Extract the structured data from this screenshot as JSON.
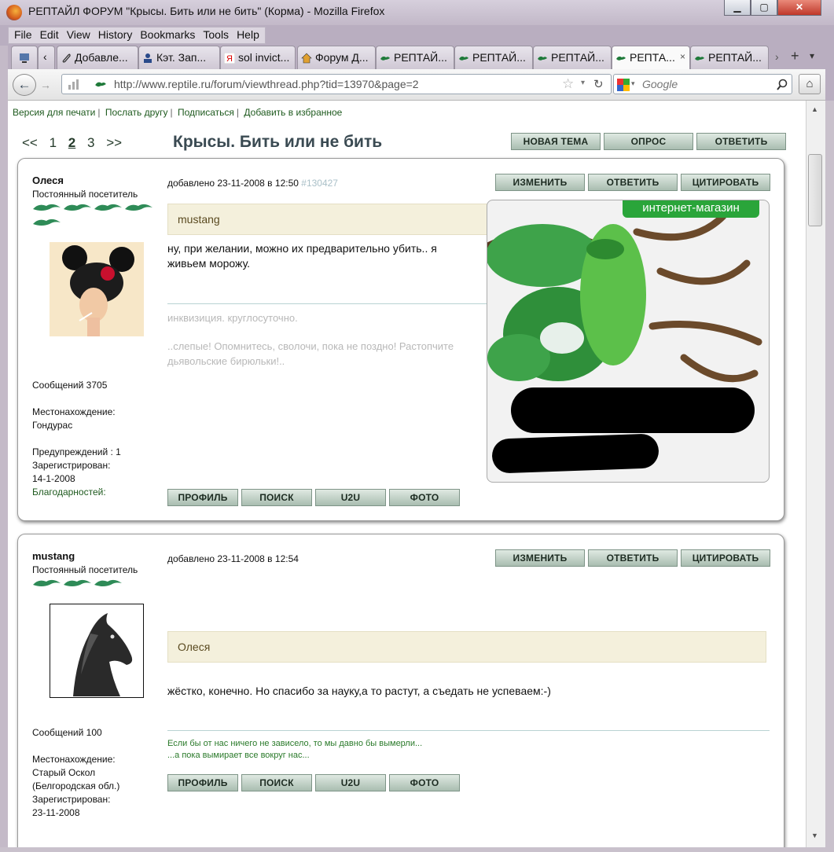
{
  "window": {
    "title": "РЕПТАЙЛ ФОРУМ \"Крысы. Бить или не бить\" (Корма) - Mozilla Firefox",
    "minimize": "▁",
    "maximize": "▢",
    "close": "✕"
  },
  "menu": [
    "File",
    "Edit",
    "View",
    "History",
    "Bookmarks",
    "Tools",
    "Help"
  ],
  "tabs": [
    "Добавле...",
    "Кэт. Зап...",
    "sol invict...",
    "Форум Д...",
    "РЕПТАЙ...",
    "РЕПТАЙ...",
    "РЕПТАЙ...",
    "РЕПТА...",
    "РЕПТАЙ..."
  ],
  "tab_close": "×",
  "nav": {
    "url": "http://www.reptile.ru/forum/viewthread.php?tid=13970&page=2",
    "search_placeholder": "Google"
  },
  "toplinks": [
    "Версия для печати",
    "Послать другу",
    "Подписаться",
    "Добавить в избранное"
  ],
  "pager": {
    "prev": "<<",
    "pages": [
      "1",
      "2",
      "3"
    ],
    "current": "2",
    "next": ">>"
  },
  "thread": {
    "title": "Крысы. Бить или не бить"
  },
  "thread_buttons": [
    "НОВАЯ ТЕМА",
    "ОПРОС",
    "ОТВЕТИТЬ"
  ],
  "post_buttons": [
    "ИЗМЕНИТЬ",
    "ОТВЕТИТЬ",
    "ЦИТИРОВАТЬ"
  ],
  "profile_buttons": [
    "ПРОФИЛЬ",
    "ПОИСК",
    "U2U",
    "ФОТО"
  ],
  "posts": [
    {
      "user": "Олеся",
      "rank": "Постоянный посетитель",
      "rank_icons": 5,
      "date": "добавлено 23-11-2008 в 12:50",
      "post_id": "#130427",
      "quote": "mustang",
      "text": "ну, при желании, можно их предварительно убить.. я живьем морожу.",
      "sig_line1": "инквизиция. круглосуточно.",
      "sig_line2": "..слепые! Опомнитесь, сволочи, пока не поздно! Растопчите дьявольские бирюльки!..",
      "messages": "Сообщений 3705",
      "location_label": "Местонахождение:",
      "location": "Гондурас",
      "warnings": "Предупреждений : 1",
      "registered_label": "Зарегистрирован:",
      "registered": "14-1-2008",
      "thanks": "Благодарностей:",
      "ad_label": "интернет-магазин"
    },
    {
      "user": "mustang",
      "rank": "Постоянный посетитель",
      "rank_icons": 3,
      "date": "добавлено 23-11-2008 в 12:54",
      "quote": "Олеся",
      "text": "жёстко, конечно. Но спасибо за науку,а то растут, а съедать не успеваем:-)",
      "sig_line1": "Если бы от нас ничего не зависело, то мы давно бы вымерли...",
      "sig_line2": "...а пока вымирает все вокруг нас...",
      "messages": "Сообщений 100",
      "location_label": "Местонахождение:",
      "location_1": "Старый Оскол",
      "location_2": "(Белгородская обл.)",
      "registered_label": "Зарегистрирован:",
      "registered": "23-11-2008"
    }
  ]
}
